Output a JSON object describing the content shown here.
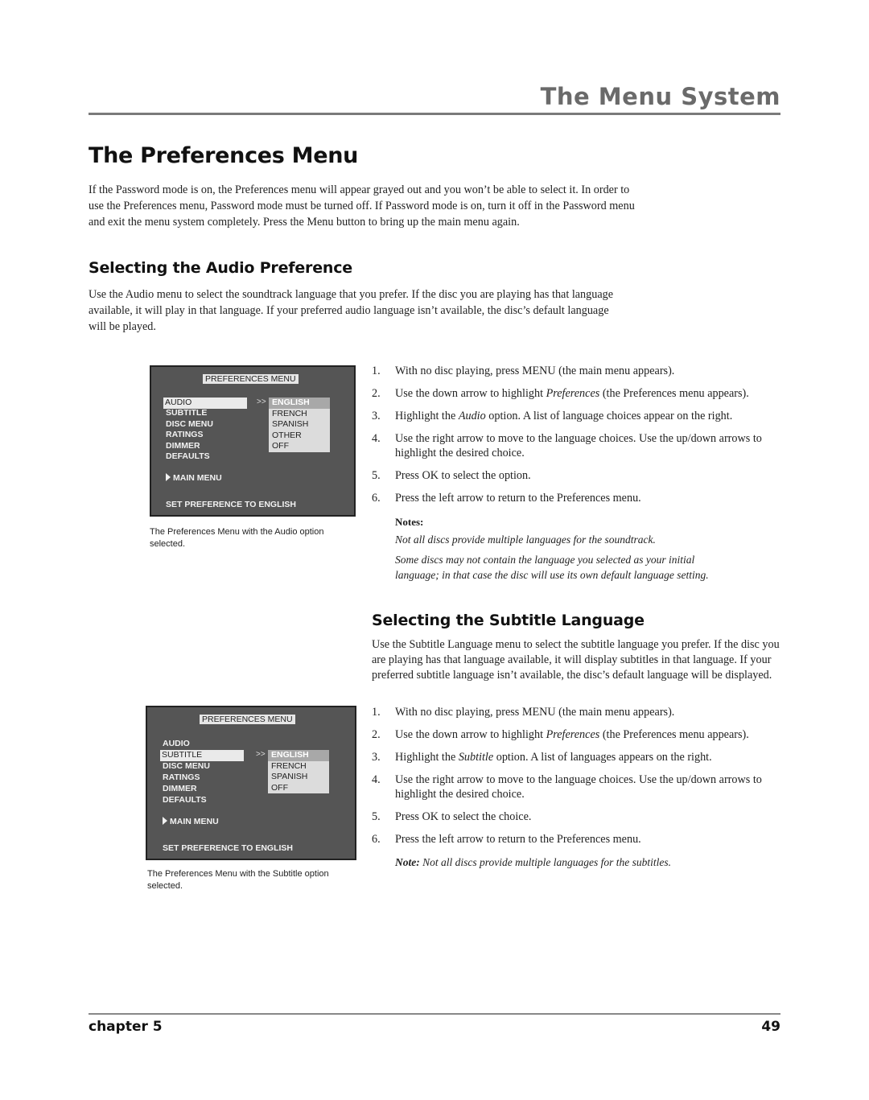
{
  "header": {
    "section_title": "The Menu System"
  },
  "page_title": "The Preferences Menu",
  "intro_paragraph": "If the Password mode is on, the Preferences menu will appear grayed out and you won’t be able to select it. In order to use the Preferences menu, Password mode must be turned off. If Password mode is on, turn it off in the Password menu and exit the menu system completely. Press the Menu button to bring up the main menu again.",
  "audio_section": {
    "heading": "Selecting the Audio Preference",
    "paragraph": "Use the Audio menu to select the soundtrack language that you prefer. If the disc you are playing has that language available, it will play in that language. If your preferred audio language isn’t available, the disc’s default language will be played.",
    "screen": {
      "title": "PREFERENCES MENU",
      "items": [
        "AUDIO",
        "SUBTITLE",
        "DISC MENU",
        "RATINGS",
        "DIMMER",
        "DEFAULTS"
      ],
      "selected_item": "AUDIO",
      "arrow": ">>",
      "languages": [
        "ENGLISH",
        "FRENCH",
        "SPANISH",
        "OTHER",
        "OFF"
      ],
      "highlighted_language": "ENGLISH",
      "main_menu": "MAIN MENU",
      "status": "SET PREFERENCE TO ENGLISH"
    },
    "caption": "The Preferences Menu with the Audio option selected.",
    "steps": [
      {
        "num": "1.",
        "pre": "With no disc playing, press MENU (the main menu appears).",
        "em": "",
        "post": ""
      },
      {
        "num": "2.",
        "pre": "Use the down arrow to highlight ",
        "em": "Preferences",
        "post": " (the Preferences menu appears)."
      },
      {
        "num": "3.",
        "pre": "Highlight the ",
        "em": "Audio",
        "post": " option. A list of language choices appear on the right."
      },
      {
        "num": "4.",
        "pre": "Use the right arrow to move to the language choices. Use the up/down arrows to highlight the desired choice.",
        "em": "",
        "post": ""
      },
      {
        "num": "5.",
        "pre": "Press OK to select the option.",
        "em": "",
        "post": ""
      },
      {
        "num": "6.",
        "pre": "Press the left arrow to return to the Preferences menu.",
        "em": "",
        "post": ""
      }
    ],
    "notes_label": "Notes:",
    "notes": [
      "Not all discs provide multiple languages for the soundtrack.",
      "Some discs may not contain the language you selected as your initial language; in that case the disc will use its own default language setting."
    ]
  },
  "subtitle_section": {
    "heading": "Selecting the Subtitle Language",
    "paragraph": "Use the Subtitle Language menu to select the subtitle language you prefer.  If the disc you are playing has that language available, it will display subtitles in that language. If your preferred subtitle language isn’t available, the disc’s default language will be displayed.",
    "screen": {
      "title": "PREFERENCES MENU",
      "items": [
        "AUDIO",
        "SUBTITLE",
        "DISC MENU",
        "RATINGS",
        "DIMMER",
        "DEFAULTS"
      ],
      "selected_item": "SUBTITLE",
      "arrow": ">>",
      "languages": [
        "ENGLISH",
        "FRENCH",
        "SPANISH",
        "OFF"
      ],
      "highlighted_language": "ENGLISH",
      "main_menu": "MAIN MENU",
      "status": "SET PREFERENCE TO ENGLISH"
    },
    "caption": "The Preferences Menu with the Subtitle option selected.",
    "steps": [
      {
        "num": "1.",
        "pre": "With no disc playing, press MENU (the main menu appears).",
        "em": "",
        "post": ""
      },
      {
        "num": "2.",
        "pre": "Use the down arrow to highlight ",
        "em": "Preferences",
        "post": " (the Preferences menu appears)."
      },
      {
        "num": "3.",
        "pre": "Highlight the ",
        "em": "Subtitle",
        "post": " option. A list of languages appears on the right."
      },
      {
        "num": "4.",
        "pre": "Use the right arrow to move to the language choices. Use the up/down arrows to highlight the desired choice.",
        "em": "",
        "post": ""
      },
      {
        "num": "5.",
        "pre": "Press OK to select the choice.",
        "em": "",
        "post": ""
      },
      {
        "num": "6.",
        "pre": "Press the left arrow to return to the Preferences menu.",
        "em": "",
        "post": ""
      }
    ],
    "note_label": "Note:",
    "note": " Not all discs provide multiple languages for the subtitles."
  },
  "footer": {
    "chapter": "chapter 5",
    "page_number": "49"
  }
}
